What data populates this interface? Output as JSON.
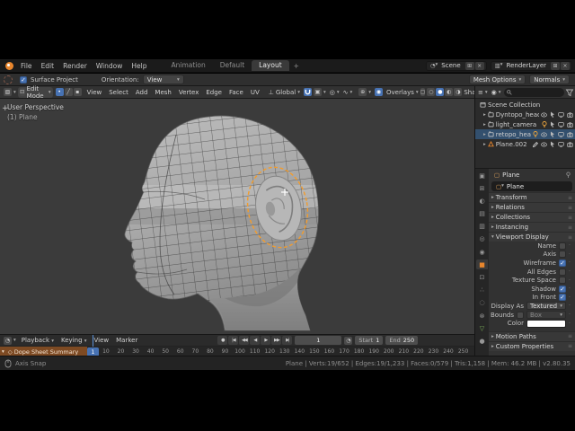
{
  "colors": {
    "accent_blue": "#4772b3",
    "selection_orange": "#f39c2c",
    "object_orange": "#e8862d",
    "channel_orange": "#7d4a23",
    "swatch_white": "#ffffff"
  },
  "topbar": {
    "menus": [
      "File",
      "Edit",
      "Render",
      "Window",
      "Help"
    ],
    "tabs": [
      {
        "label": "Animation",
        "active": false
      },
      {
        "label": "Default",
        "active": false
      },
      {
        "label": "Layout",
        "active": true
      }
    ],
    "new_tab_label": "+",
    "scene": {
      "label": "Scene",
      "new_icon": "⊞",
      "unlink_icon": "×"
    },
    "view_layer": {
      "label": "RenderLayer",
      "new_icon": "⊞",
      "unlink_icon": "×"
    }
  },
  "tool_settings": {
    "surface_project": {
      "label": "Surface Project",
      "checked": true
    },
    "orientation_label": "Orientation:",
    "orientation_value": "View",
    "mesh_options_label": "Mesh Options",
    "normals_label": "Normals"
  },
  "viewport_header": {
    "mode": "Edit Mode",
    "select_modes": [
      {
        "name": "vertex",
        "active": true
      },
      {
        "name": "edge",
        "active": false
      },
      {
        "name": "face",
        "active": false
      }
    ],
    "menus": [
      "View",
      "Select",
      "Add",
      "Mesh",
      "Vertex",
      "Edge",
      "Face",
      "UV"
    ],
    "orientation": "Global",
    "snap_on": true,
    "overlays_label": "Overlays",
    "shading_label": "Shading",
    "shading_active": "solid"
  },
  "viewport": {
    "overlay_line1": "User Perspective",
    "overlay_line2": "(1) Plane",
    "toolbar_expand": "+"
  },
  "outliner": {
    "rows": [
      {
        "label": "Scene Collection",
        "icon": "box-icon",
        "caret": "",
        "selected": false,
        "right_icons": []
      },
      {
        "label": "Dyntopo_head",
        "icon": "collection-icon",
        "caret": "▸",
        "selected": false,
        "right_icons": [
          "eye-icon",
          "cursor-icon",
          "monitor-icon",
          "camera-icon"
        ]
      },
      {
        "label": "light_camera",
        "icon": "collection-icon",
        "caret": "▸",
        "selected": false,
        "mid_icon": "bulb-icon",
        "right_icons": [
          "cursor-icon",
          "monitor-icon",
          "camera-icon"
        ]
      },
      {
        "label": "retopo_head",
        "icon": "collection-icon",
        "caret": "▸",
        "selected": true,
        "mid_icon": "bulb-icon",
        "right_icons": [
          "eye-icon",
          "cursor-icon",
          "monitor-icon",
          "camera-icon"
        ]
      },
      {
        "label": "Plane.002",
        "icon": "mesh-icon",
        "caret": "▸",
        "selected": false,
        "mid_icon": "edit-icon",
        "right_icons": [
          "eye-icon",
          "cursor-icon",
          "monitor-icon",
          "camera-icon"
        ]
      }
    ]
  },
  "properties": {
    "tabs": [
      "tool",
      "render",
      "output",
      "view-layer",
      "scene",
      "world",
      "object",
      "modifiers",
      "particles",
      "physics",
      "constraints",
      "object-data",
      "material"
    ],
    "active_tab": "object",
    "breadcrumb": "Plane",
    "name_value": "Plane",
    "panels_top": [
      "Transform",
      "Relations",
      "Collections",
      "Instancing"
    ],
    "viewport_display": {
      "title": "Viewport Display",
      "checks": [
        {
          "label": "Name",
          "checked": false
        },
        {
          "label": "Axis",
          "checked": false
        },
        {
          "label": "Wireframe",
          "checked": true
        },
        {
          "label": "All Edges",
          "checked": false
        },
        {
          "label": "Texture Space",
          "checked": false
        },
        {
          "label": "Shadow",
          "checked": true
        },
        {
          "label": "In Front",
          "checked": true
        }
      ],
      "display_as_label": "Display As",
      "display_as_value": "Textured",
      "bounds_label": "Bounds",
      "bounds_checked": false,
      "bounds_value": "Box",
      "color_label": "Color"
    },
    "panels_bottom": [
      "Motion Paths",
      "Custom Properties"
    ]
  },
  "timeline": {
    "menus": [
      "Playback",
      "Keying",
      "View",
      "Marker"
    ],
    "playback_buttons": [
      "record",
      "jump-start",
      "prev-keyframe",
      "play-reverse",
      "play",
      "next-keyframe",
      "jump-end"
    ],
    "current_frame": "1",
    "start_label": "Start",
    "start_value": "1",
    "end_label": "End",
    "end_value": "250",
    "channel_label": "Dope Sheet Summary",
    "ruler_ticks": [
      10,
      20,
      30,
      40,
      50,
      60,
      70,
      80,
      90,
      100,
      110,
      120,
      130,
      140,
      150,
      160,
      170,
      180,
      190,
      200,
      210,
      220,
      230,
      240,
      250
    ]
  },
  "status_bar": {
    "left": "Axis Snap",
    "right": "Plane | Verts:19/652 | Edges:19/1,233 | Faces:0/579 | Tris:1,158 | Mem: 46.2 MB | v2.80.35"
  }
}
